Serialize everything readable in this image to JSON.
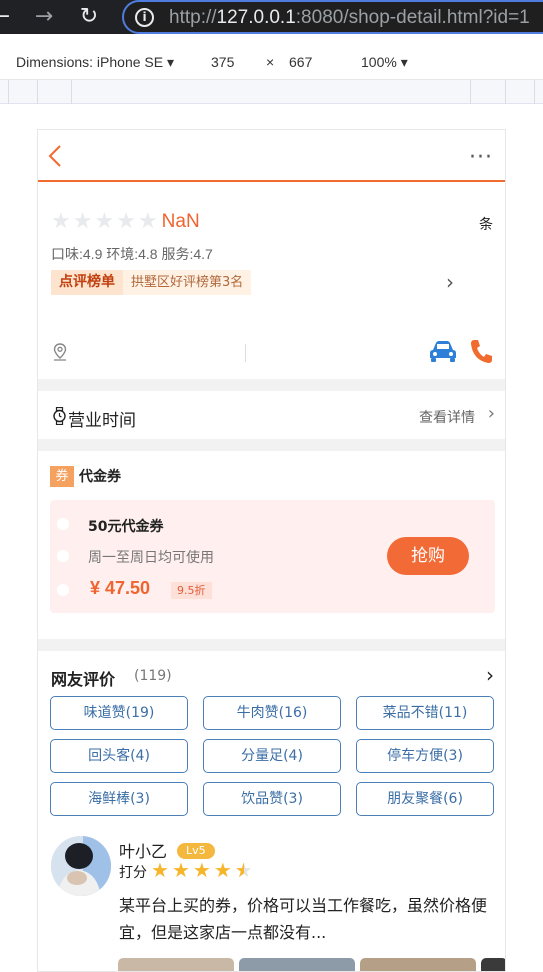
{
  "browser": {
    "url_prefix": "http://",
    "url_host": "127.0.0.1",
    "url_rest": ":8080/shop-detail.html?id=1",
    "nav_back": "←",
    "nav_forward": "→",
    "nav_reload": "↻"
  },
  "devtools": {
    "dimensions_label": "Dimensions: iPhone SE ▾",
    "width": "375",
    "times": "×",
    "height": "667",
    "zoom": "100% ▾"
  },
  "header": {
    "more": "···"
  },
  "shop": {
    "score": "NaN",
    "review_unit": "条",
    "sub_scores": "口味:4.9 环境:4.8 服务:4.7",
    "rank_badge": "点评榜单",
    "rank_text": "拱墅区好评榜第3名",
    "rank_chevron": "›"
  },
  "hours": {
    "label": "营业时间",
    "link": "查看详情",
    "chevron": "›"
  },
  "voucher": {
    "tag": "券",
    "title": "代金券",
    "name": "50元代金券",
    "desc": "周一至周日均可使用",
    "price": "¥ 47.50",
    "discount": "9.5折",
    "buy": "抢购"
  },
  "reviews": {
    "title": "网友评价",
    "count": "(119)",
    "chevron": "›",
    "tags": [
      "味道赞(19)",
      "牛肉赞(16)",
      "菜品不错(11)",
      "回头客(4)",
      "分量足(4)",
      "停车方便(3)",
      "海鲜棒(3)",
      "饮品赞(3)",
      "朋友聚餐(6)"
    ],
    "first": {
      "name": "叶小乙",
      "level": "Lv5",
      "score_label": "打分",
      "rating": 4.5,
      "text": "某平台上买的券，价格可以当工作餐吃，虽然价格便宜，但是这家店一点都没有..."
    }
  },
  "colors": {
    "accent": "#f26b2e",
    "tag_border": "#4b7fb6",
    "star": "#f7b52c",
    "voucher_bg": "#fff0ef"
  }
}
